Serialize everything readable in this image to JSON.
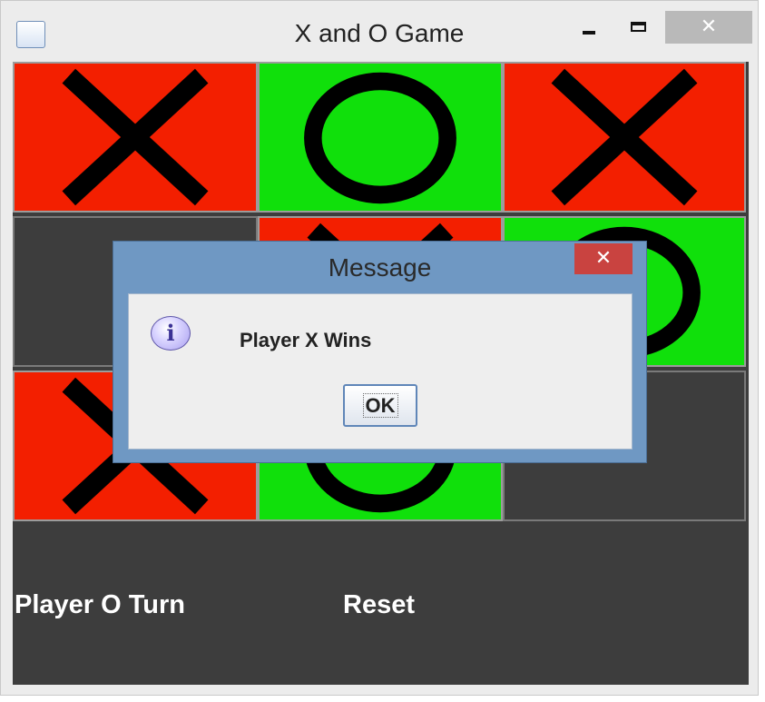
{
  "window": {
    "title": "X and O Game",
    "icon": "java-cup-icon",
    "controls": {
      "minimize": "minimize-icon",
      "maximize": "maximize-icon",
      "close": "✕"
    }
  },
  "board": {
    "cells": [
      "X",
      "O",
      "X",
      "",
      "X",
      "O",
      "X",
      "O",
      ""
    ],
    "colors": {
      "X": "#f31f00",
      "O": "#10e00b",
      "empty": "#3d3d3d"
    }
  },
  "status": {
    "turn_label": "Player O Turn",
    "reset_label": "Reset"
  },
  "dialog": {
    "title": "Message",
    "close": "✕",
    "icon": "info-icon",
    "icon_glyph": "i",
    "message": "Player X Wins",
    "ok_label": "OK"
  }
}
